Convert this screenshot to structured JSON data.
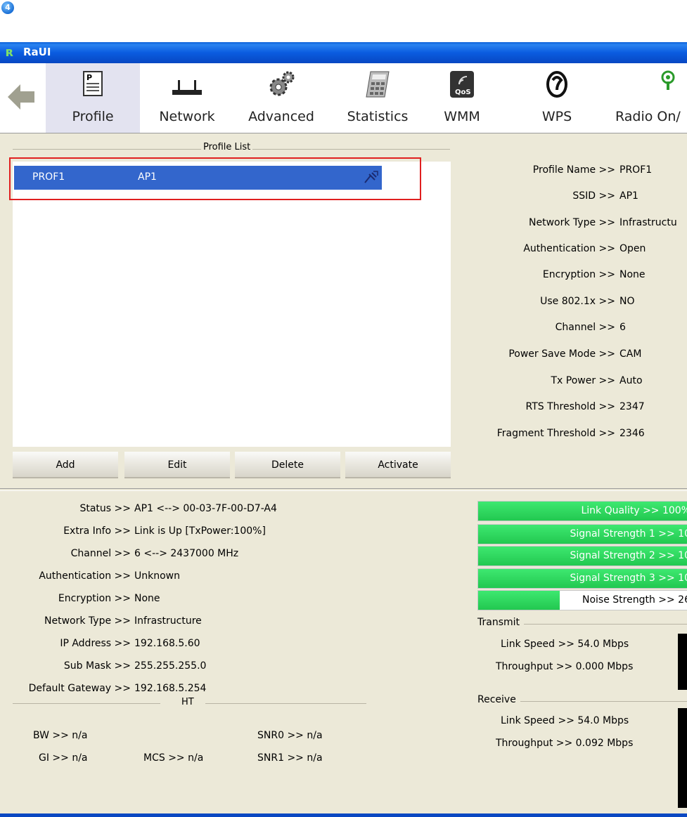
{
  "step_badge": "4",
  "window": {
    "title": "RaUI"
  },
  "toolbar": {
    "items": [
      {
        "label": "Profile"
      },
      {
        "label": "Network"
      },
      {
        "label": "Advanced"
      },
      {
        "label": "Statistics"
      },
      {
        "label": "WMM"
      },
      {
        "label": "WPS"
      },
      {
        "label": "Radio On/"
      }
    ],
    "qos_badge": "QoS"
  },
  "profile_list": {
    "title": "Profile List",
    "rows": [
      {
        "name": "PROF1",
        "ssid": "AP1"
      }
    ],
    "buttons": {
      "add": "Add",
      "edit": "Edit",
      "delete": "Delete",
      "activate": "Activate"
    }
  },
  "profile_details": [
    {
      "key": "Profile Name >>",
      "value": "PROF1"
    },
    {
      "key": "SSID >>",
      "value": "AP1"
    },
    {
      "key": "Network Type >>",
      "value": "Infrastructu"
    },
    {
      "key": "Authentication >>",
      "value": "Open"
    },
    {
      "key": "Encryption >>",
      "value": "None"
    },
    {
      "key": "Use 802.1x >>",
      "value": "NO"
    },
    {
      "key": "Channel >>",
      "value": "6"
    },
    {
      "key": "Power Save Mode >>",
      "value": "CAM"
    },
    {
      "key": "Tx Power >>",
      "value": "Auto"
    },
    {
      "key": "RTS Threshold >>",
      "value": "2347"
    },
    {
      "key": "Fragment Threshold >>",
      "value": "2346"
    }
  ],
  "status": [
    {
      "key": "Status >>",
      "value": "AP1 <--> 00-03-7F-00-D7-A4"
    },
    {
      "key": "Extra Info >>",
      "value": "Link is Up [TxPower:100%]"
    },
    {
      "key": "Channel >>",
      "value": "6 <--> 2437000 MHz"
    },
    {
      "key": "Authentication >>",
      "value": "Unknown"
    },
    {
      "key": "Encryption >>",
      "value": "None"
    },
    {
      "key": "Network Type >>",
      "value": "Infrastructure"
    },
    {
      "key": "IP Address >>",
      "value": "192.168.5.60"
    },
    {
      "key": "Sub Mask >>",
      "value": "255.255.255.0"
    },
    {
      "key": "Default Gateway >>",
      "value": "192.168.5.254"
    }
  ],
  "ht": {
    "title": "HT",
    "bw": "BW >> n/a",
    "gi": "GI >> n/a",
    "mcs": "MCS >> n/a",
    "snr0": "SNR0 >> n/a",
    "snr1": "SNR1 >> n/a"
  },
  "quality": [
    {
      "label": "Link Quality >> 100%",
      "level_percent": 100
    },
    {
      "label": "Signal Strength 1 >> 10",
      "level_percent": 100
    },
    {
      "label": "Signal Strength 2 >> 10",
      "level_percent": 100
    },
    {
      "label": "Signal Strength 3 >> 10",
      "level_percent": 100
    },
    {
      "label": "Noise Strength >> 26",
      "level_percent": 39
    }
  ],
  "transmit": {
    "title": "Transmit",
    "link_speed": "Link Speed >> 54.0 Mbps",
    "throughput": "Throughput >> 0.000 Mbps"
  },
  "receive": {
    "title": "Receive",
    "link_speed": "Link Speed >> 54.0 Mbps",
    "throughput": "Throughput >> 0.092 Mbps"
  },
  "colors": {
    "titlebar": "#0a5ce0",
    "selection": "#3366cc",
    "highlight_frame": "#e02020",
    "bar_fill": "#22c850",
    "window_bg": "#ece9d8"
  }
}
